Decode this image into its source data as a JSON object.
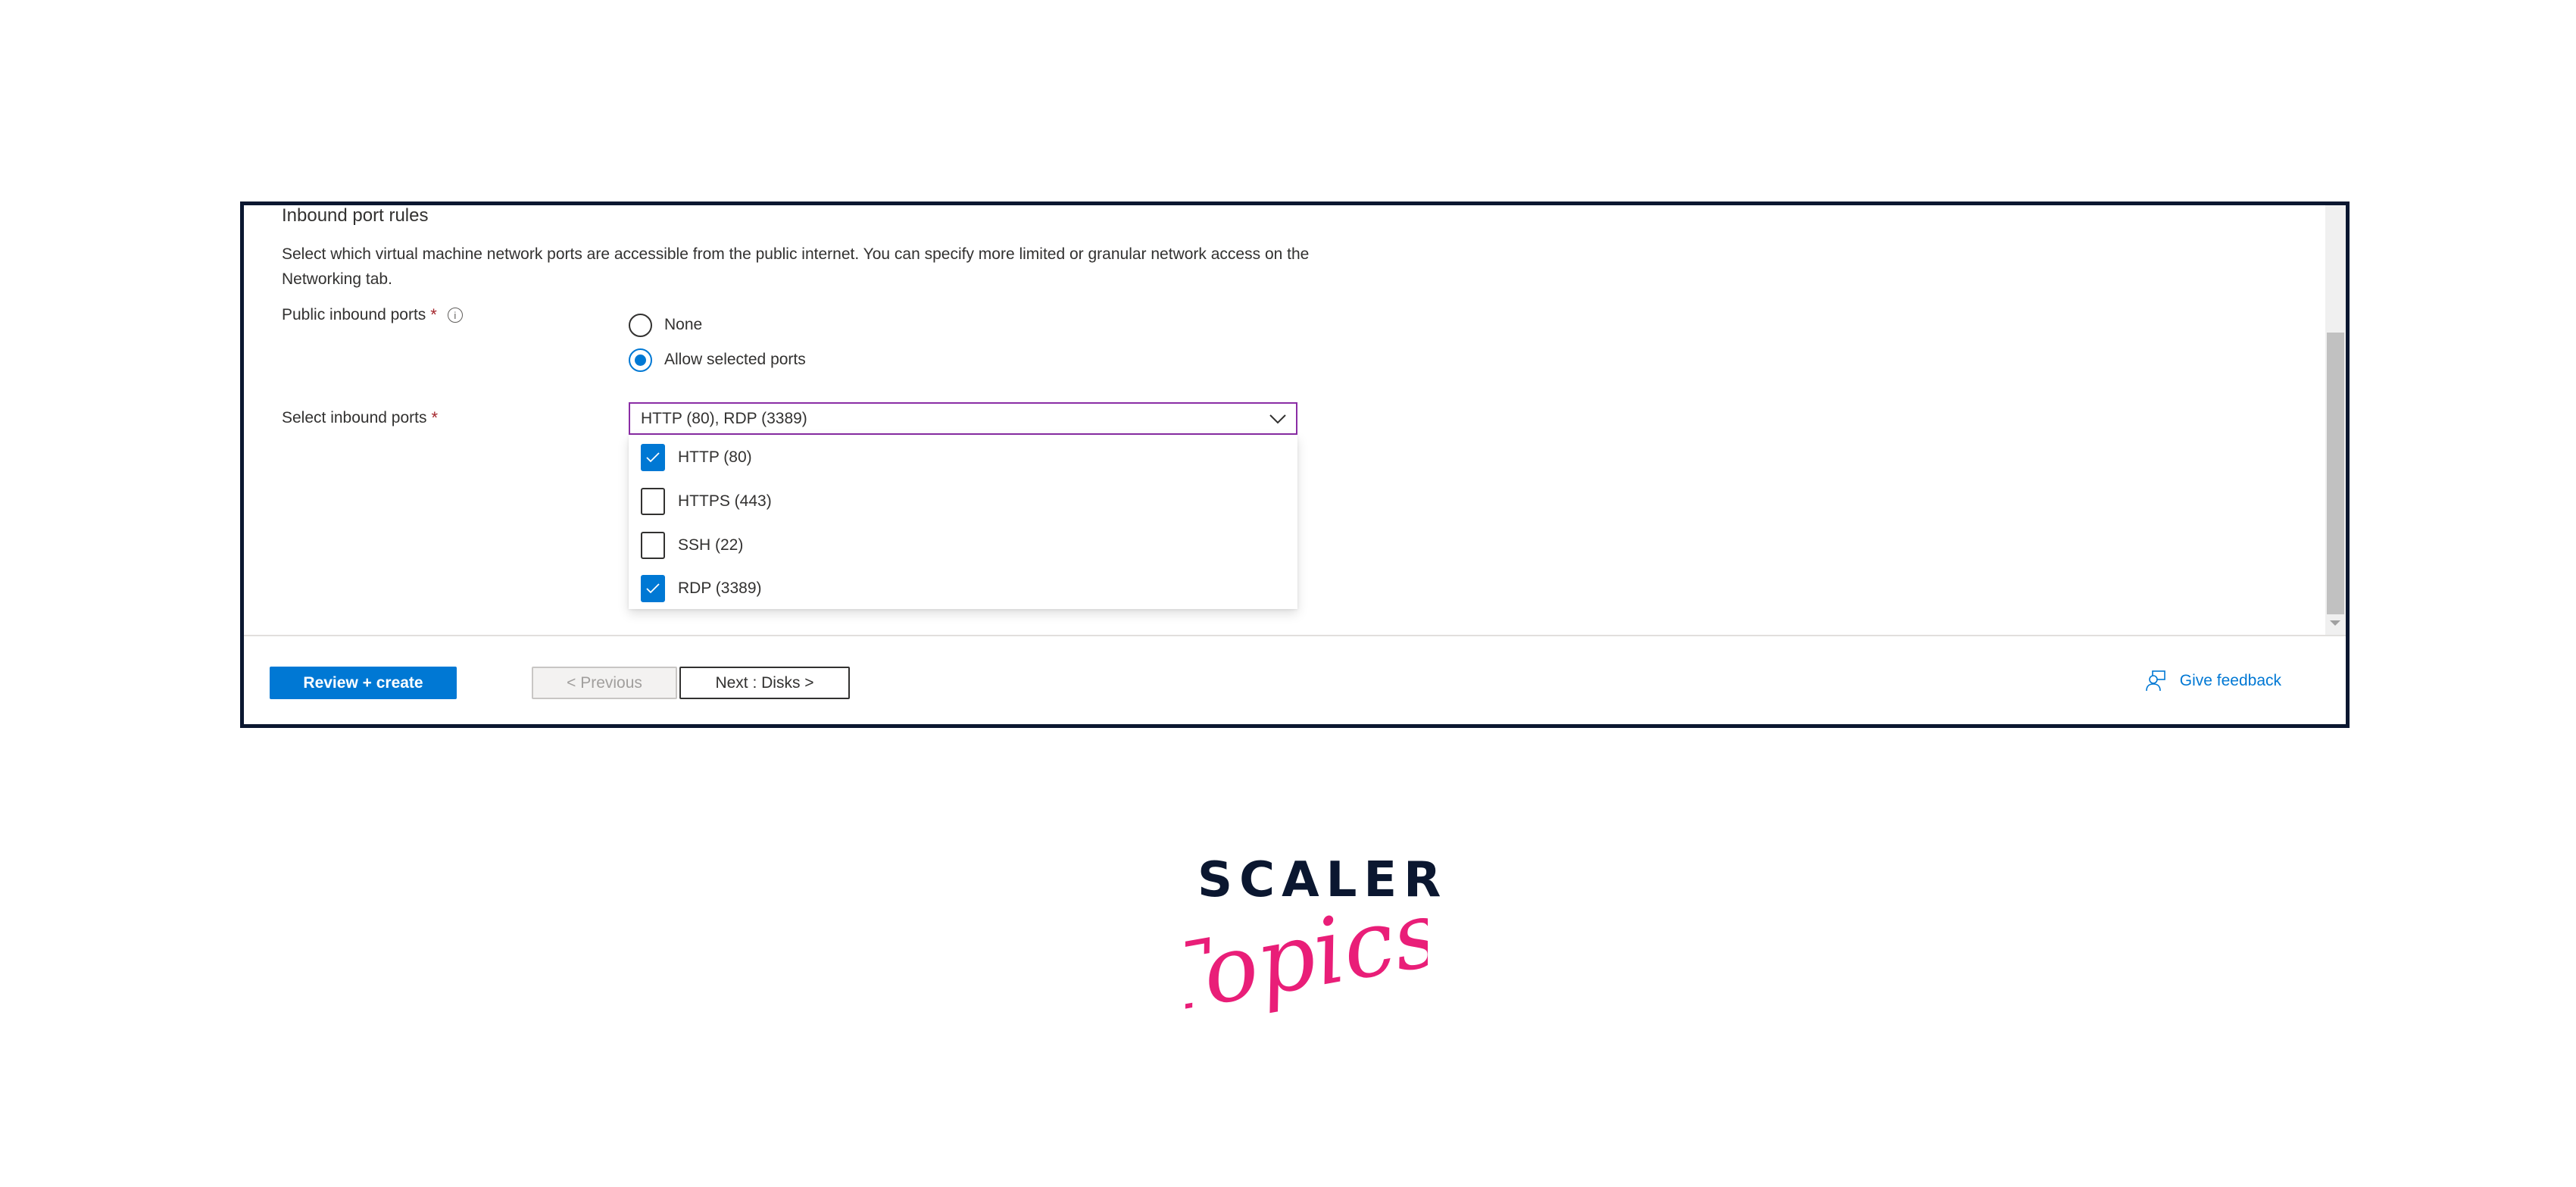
{
  "section": {
    "title": "Inbound port rules",
    "description": "Select which virtual machine network ports are accessible from the public internet. You can specify more limited or granular network access on the Networking tab."
  },
  "public_inbound_ports": {
    "label": "Public inbound ports",
    "required_marker": "*",
    "info_icon": "info-icon",
    "options": [
      {
        "label": "None",
        "selected": false
      },
      {
        "label": "Allow selected ports",
        "selected": true
      }
    ]
  },
  "select_inbound_ports": {
    "label": "Select inbound ports",
    "required_marker": "*",
    "value": "HTTP (80), RDP (3389)",
    "expanded": true,
    "options": [
      {
        "label": "HTTP (80)",
        "checked": true
      },
      {
        "label": "HTTPS (443)",
        "checked": false
      },
      {
        "label": "SSH (22)",
        "checked": false
      },
      {
        "label": "RDP (3389)",
        "checked": true
      }
    ]
  },
  "footer": {
    "review_create_label": "Review + create",
    "previous_label": "< Previous",
    "next_label": "Next : Disks >",
    "feedback_label": "Give feedback",
    "feedback_icon": "feedback-person-icon"
  },
  "branding": {
    "logo_top": "SCALER",
    "logo_script": "Topics",
    "logo_top_color": "#0b1730",
    "logo_script_color": "#e91e78"
  },
  "colors": {
    "accent": "#0078d4",
    "required": "#a4262c",
    "focus_border": "#8a2da5",
    "frame_border": "#0b1730"
  }
}
